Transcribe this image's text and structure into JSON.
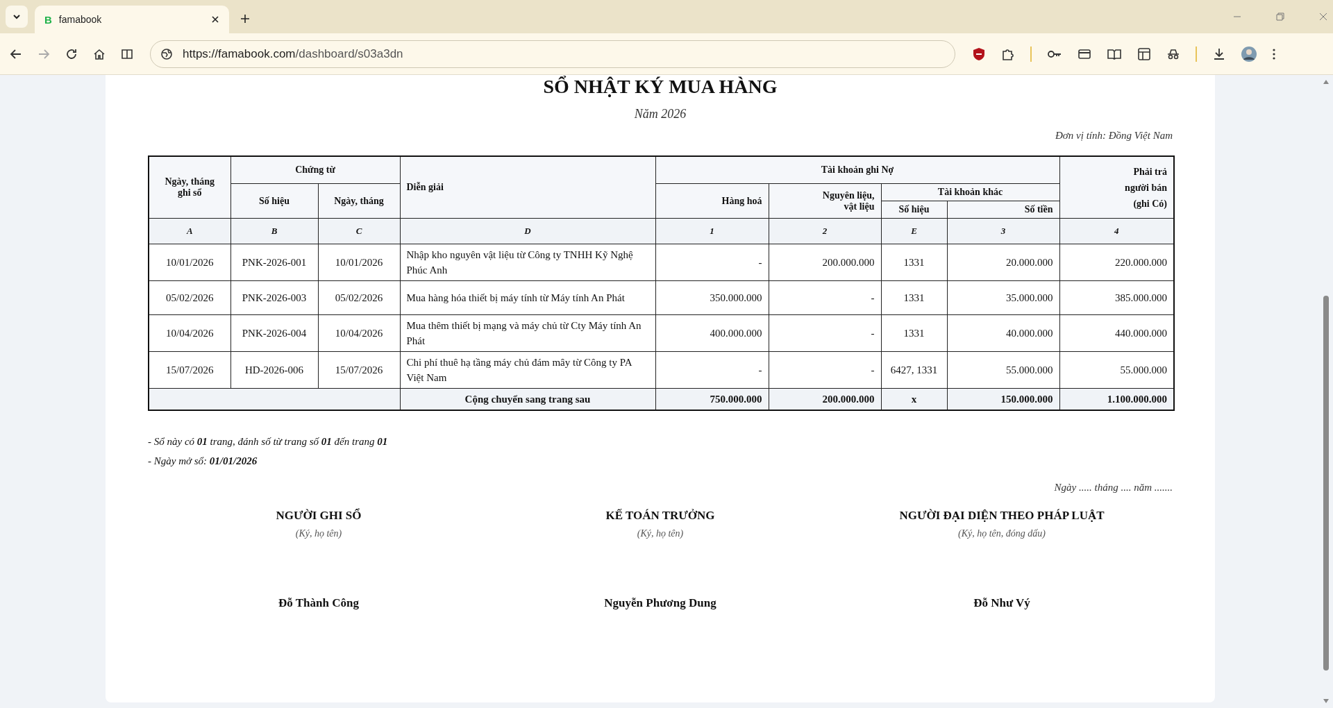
{
  "browser": {
    "tabs": [
      {
        "favicon": "B",
        "title": "famabook",
        "selected": true
      }
    ],
    "url_host": "https://famabook.com",
    "url_path": "/dashboard/s03a3dn",
    "forward_disabled": true
  },
  "document": {
    "title": "SỔ NHẬT KÝ MUA HÀNG",
    "year": "Năm 2026",
    "unit": "Đơn vị tính: Đồng Việt Nam",
    "header": {
      "date": "Ngày, tháng ghi sổ",
      "voucher": "Chứng từ",
      "voucher_no": "Số hiệu",
      "voucher_date": "Ngày, tháng",
      "description": "Diễn giải",
      "debit": "Tài khoản ghi Nợ",
      "goods": "Hàng hoá",
      "materials": "Nguyên liệu, vật liệu",
      "other": "Tài khoản khác",
      "other_no": "Số hiệu",
      "other_amount": "Số tiền",
      "payable": "Phải trả người bán (ghi Có)"
    },
    "codes": [
      "A",
      "B",
      "C",
      "D",
      "1",
      "2",
      "E",
      "3",
      "4"
    ],
    "rows": [
      {
        "cells": [
          "10/01/2026",
          "PNK-2026-001",
          "10/01/2026",
          "Nhập kho nguyên vật liệu từ Công ty TNHH Kỹ Nghệ Phúc Anh",
          "-",
          "200.000.000",
          "1331",
          "20.000.000",
          "220.000.000"
        ]
      },
      {
        "cells": [
          "05/02/2026",
          "PNK-2026-003",
          "05/02/2026",
          "Mua hàng hóa thiết bị máy tính từ Máy tính An Phát",
          "350.000.000",
          "-",
          "1331",
          "35.000.000",
          "385.000.000"
        ]
      },
      {
        "cells": [
          "10/04/2026",
          "PNK-2026-004",
          "10/04/2026",
          "Mua thêm thiết bị mạng và máy chủ từ Cty Máy tính An Phát",
          "400.000.000",
          "-",
          "1331",
          "40.000.000",
          "440.000.000"
        ]
      },
      {
        "cells": [
          "15/07/2026",
          "HD-2026-006",
          "15/07/2026",
          "Chi phí thuê hạ tầng máy chủ đám mây từ Công ty PA Việt Nam",
          "-",
          "-",
          "6427, 1331",
          "55.000.000",
          "55.000.000"
        ]
      }
    ],
    "total": {
      "label": "Cộng chuyển sang trang sau",
      "values": [
        "750.000.000",
        "200.000.000",
        "x",
        "150.000.000",
        "1.100.000.000"
      ]
    },
    "notes": [
      "- Sổ này có **01** trang, đánh số từ trang số **01** đến trang **01**",
      "- Ngày mở sổ: **01/01/2026**"
    ],
    "date_line": "Ngày ..... tháng .... năm .......",
    "signatures": [
      {
        "role": "NGƯỜI GHI SỔ",
        "hint": "(Ký, họ tên)",
        "name": "Đỗ Thành Công"
      },
      {
        "role": "KẾ TOÁN TRƯỞNG",
        "hint": "(Ký, họ tên)",
        "name": "Nguyễn Phương Dung"
      },
      {
        "role": "NGƯỜI ĐẠI DIỆN THEO PHÁP LUẬT",
        "hint": "(Ký, họ tên, đóng dấu)",
        "name": "Đỗ Như Vý"
      }
    ]
  }
}
